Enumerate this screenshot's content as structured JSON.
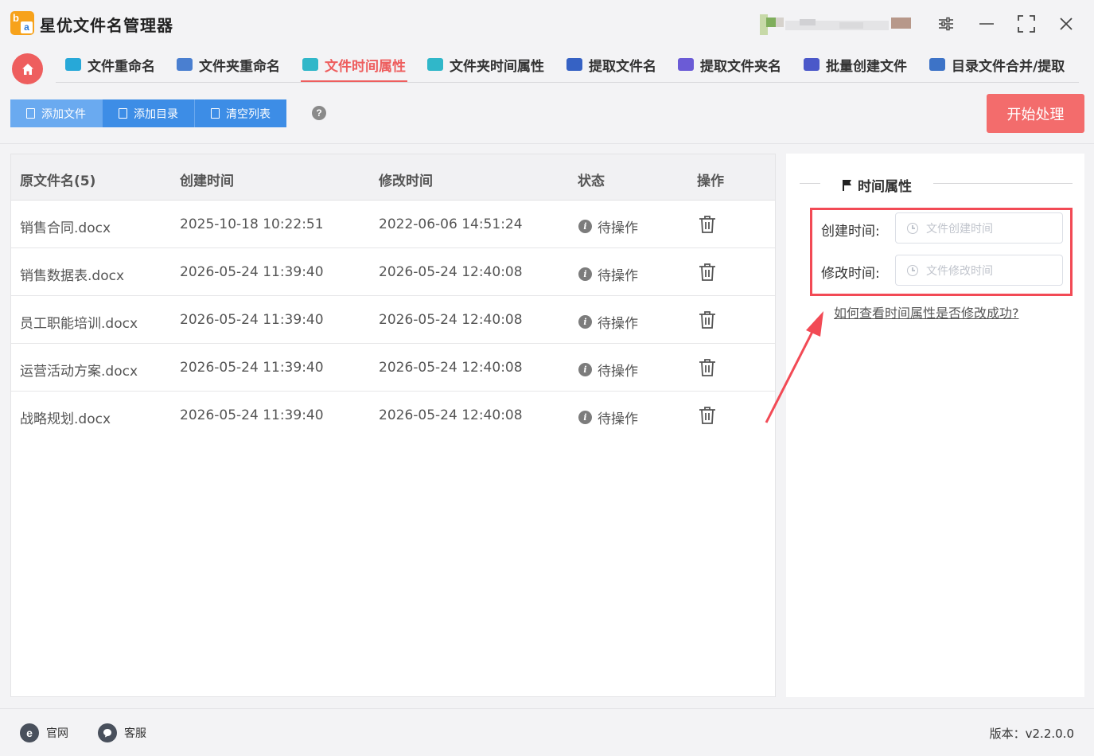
{
  "app": {
    "title": "星优文件名管理器"
  },
  "nav": {
    "tabs": [
      {
        "label": "文件重命名",
        "icon": "rename-file-icon",
        "color": "#27a8d8"
      },
      {
        "label": "文件夹重命名",
        "icon": "rename-folder-icon",
        "color": "#4a7fd0"
      },
      {
        "label": "文件时间属性",
        "icon": "file-time-icon",
        "color": "#30b7c9"
      },
      {
        "label": "文件夹时间属性",
        "icon": "folder-time-icon",
        "color": "#30b7c9"
      },
      {
        "label": "提取文件名",
        "icon": "extract-filename-icon",
        "color": "#3662c4"
      },
      {
        "label": "提取文件夹名",
        "icon": "extract-foldername-icon",
        "color": "#6b5bd6"
      },
      {
        "label": "批量创建文件",
        "icon": "batch-create-icon",
        "color": "#4b58c9"
      },
      {
        "label": "目录文件合并/提取",
        "icon": "merge-extract-icon",
        "color": "#3d73c7"
      }
    ],
    "active_index": 2
  },
  "toolbar": {
    "add_file": "添加文件",
    "add_dir": "添加目录",
    "clear_list": "清空列表",
    "help": "?",
    "start": "开始处理"
  },
  "table": {
    "headers": {
      "name": "原文件名(5)",
      "created": "创建时间",
      "modified": "修改时间",
      "status": "状态",
      "action": "操作"
    },
    "rows": [
      {
        "name": "销售合同.docx",
        "created": "2025-10-18 10:22:51",
        "modified": "2022-06-06 14:51:24",
        "status": "待操作"
      },
      {
        "name": "销售数据表.docx",
        "created": "2026-05-24 11:39:40",
        "modified": "2026-05-24 12:40:08",
        "status": "待操作"
      },
      {
        "name": "员工职能培训.docx",
        "created": "2026-05-24 11:39:40",
        "modified": "2026-05-24 12:40:08",
        "status": "待操作"
      },
      {
        "name": "运营活动方案.docx",
        "created": "2026-05-24 11:39:40",
        "modified": "2026-05-24 12:40:08",
        "status": "待操作"
      },
      {
        "name": "战略规划.docx",
        "created": "2026-05-24 11:39:40",
        "modified": "2026-05-24 12:40:08",
        "status": "待操作"
      }
    ]
  },
  "panel": {
    "title": "时间属性",
    "created_label": "创建时间:",
    "created_placeholder": "文件创建时间",
    "modified_label": "修改时间:",
    "modified_placeholder": "文件修改时间",
    "help_link": "如何查看时间属性是否修改成功?"
  },
  "footer": {
    "website": "官网",
    "service": "客服",
    "version": "版本：v2.2.0.0"
  },
  "colors": {
    "accent": "#ee5e5e",
    "primary": "#3d8de6",
    "highlight": "#f24a55"
  }
}
